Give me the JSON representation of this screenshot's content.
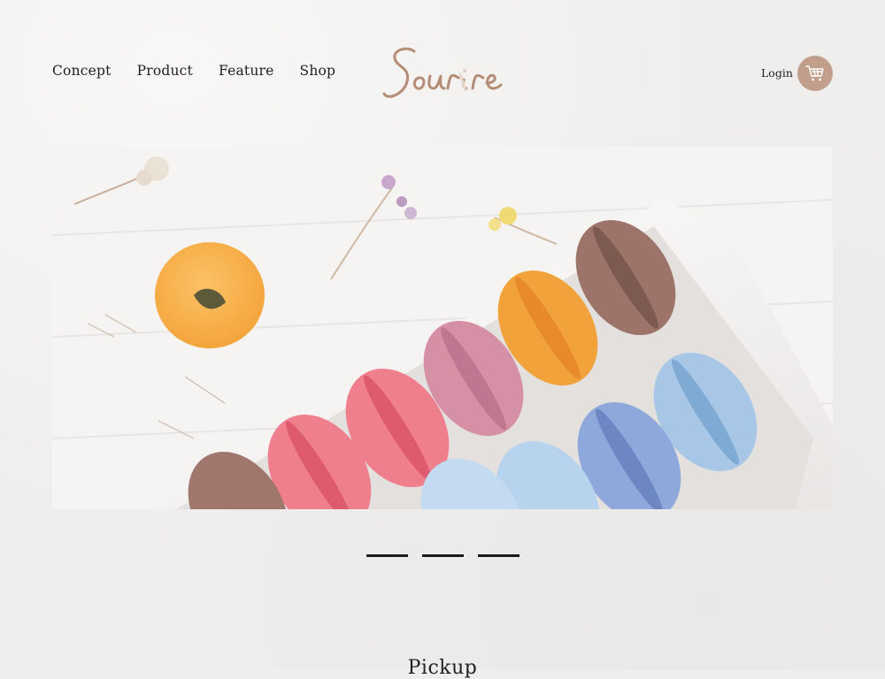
{
  "nav": {
    "items": [
      "Concept",
      "Product",
      "Feature",
      "Shop"
    ]
  },
  "logo": {
    "text": "Sourire",
    "accent_color": "#b58d76"
  },
  "header": {
    "login_label": "Login",
    "cart_icon": "cart-icon",
    "cart_bg": "#c19f8c"
  },
  "hero": {
    "image_subject": "macarons-in-box",
    "slides": 3
  },
  "section": {
    "title": "Pickup"
  }
}
